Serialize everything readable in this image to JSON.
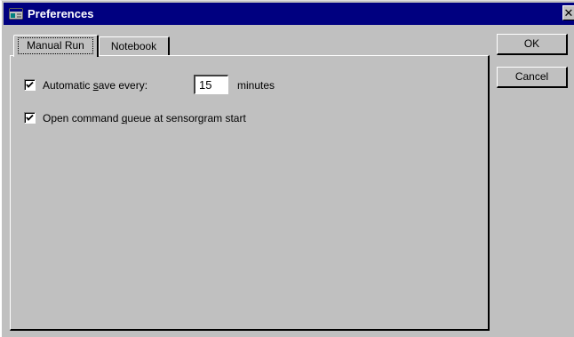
{
  "window": {
    "title": "Preferences",
    "close_glyph": "✕",
    "icon": "preferences-app-icon"
  },
  "tabs": [
    {
      "label": "Manual Run",
      "selected": true
    },
    {
      "label": "Notebook",
      "selected": false
    }
  ],
  "manual_run": {
    "auto_save": {
      "checked": true,
      "label_before": "Automatic ",
      "label_mnemonic": "s",
      "label_after": "ave every:",
      "minutes_value": "15",
      "minutes_label": "minutes"
    },
    "command_queue": {
      "checked": true,
      "label_before": "Open command ",
      "label_mnemonic": "q",
      "label_after": "ueue at sensorgram start"
    }
  },
  "buttons": {
    "ok": "OK",
    "cancel": "Cancel"
  },
  "colors": {
    "titlebar": "#000080",
    "face": "#c0c0c0"
  }
}
